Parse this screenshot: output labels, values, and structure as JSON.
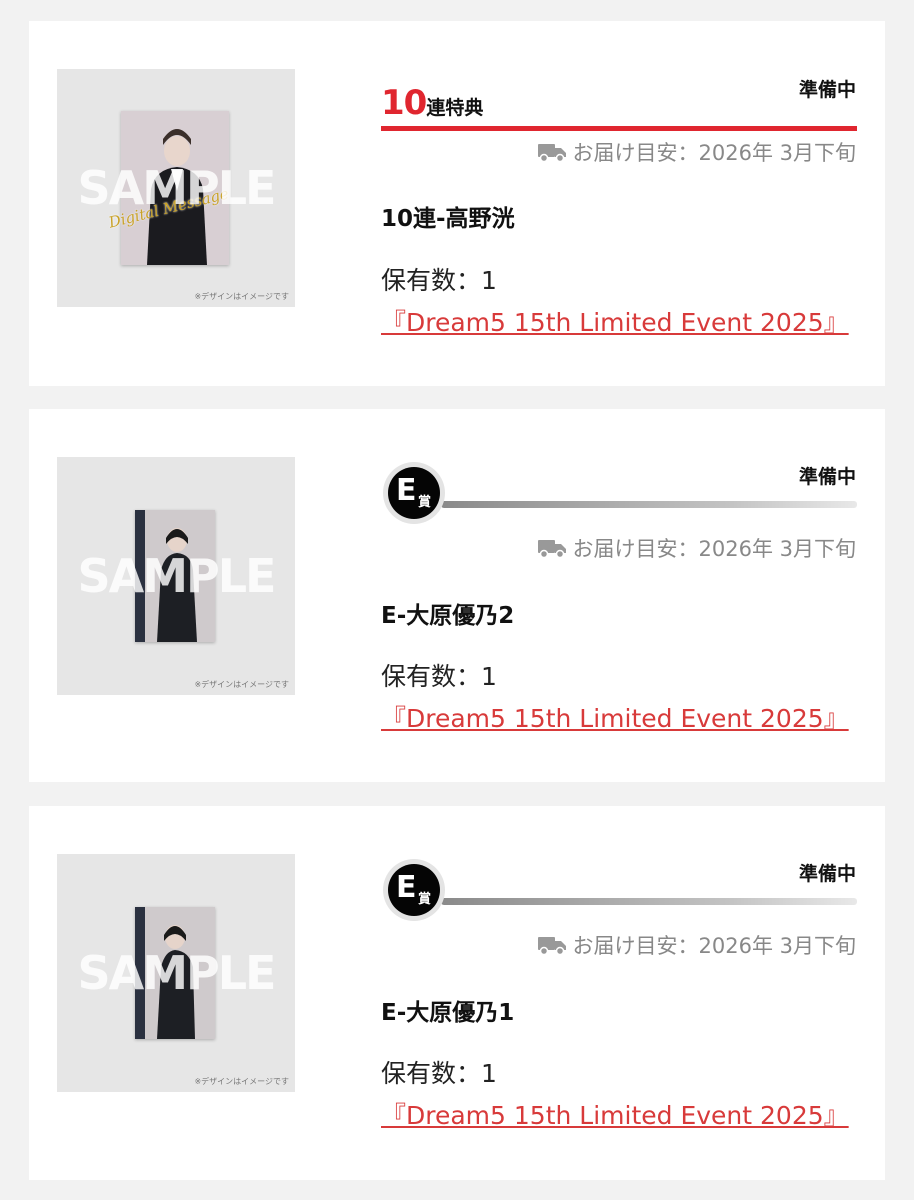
{
  "common": {
    "thumb_note": "※デザインはイメージです",
    "sample_watermark": "SAMPLE",
    "owned_label": "保有数：",
    "delivery_label": "お届け目安：",
    "accent_color": "#e0262f",
    "link_color": "#d83a3a"
  },
  "items": [
    {
      "rank_number": "10",
      "rank_suffix": "連特典",
      "status": "準備中",
      "delivery_date": "2026年 3月下旬",
      "title": "10連-高野洸",
      "owned_count": "1",
      "link_text": "『Dream5 15th Limited Event 2025』",
      "overlay_text": "Digital Message"
    },
    {
      "badge_letter": "E",
      "badge_kanji": "賞",
      "status": "準備中",
      "delivery_date": "2026年 3月下旬",
      "title": "E-大原優乃2",
      "owned_count": "1",
      "link_text": "『Dream5 15th Limited Event 2025』"
    },
    {
      "badge_letter": "E",
      "badge_kanji": "賞",
      "status": "準備中",
      "delivery_date": "2026年 3月下旬",
      "title": "E-大原優乃1",
      "owned_count": "1",
      "link_text": "『Dream5 15th Limited Event 2025』"
    }
  ]
}
